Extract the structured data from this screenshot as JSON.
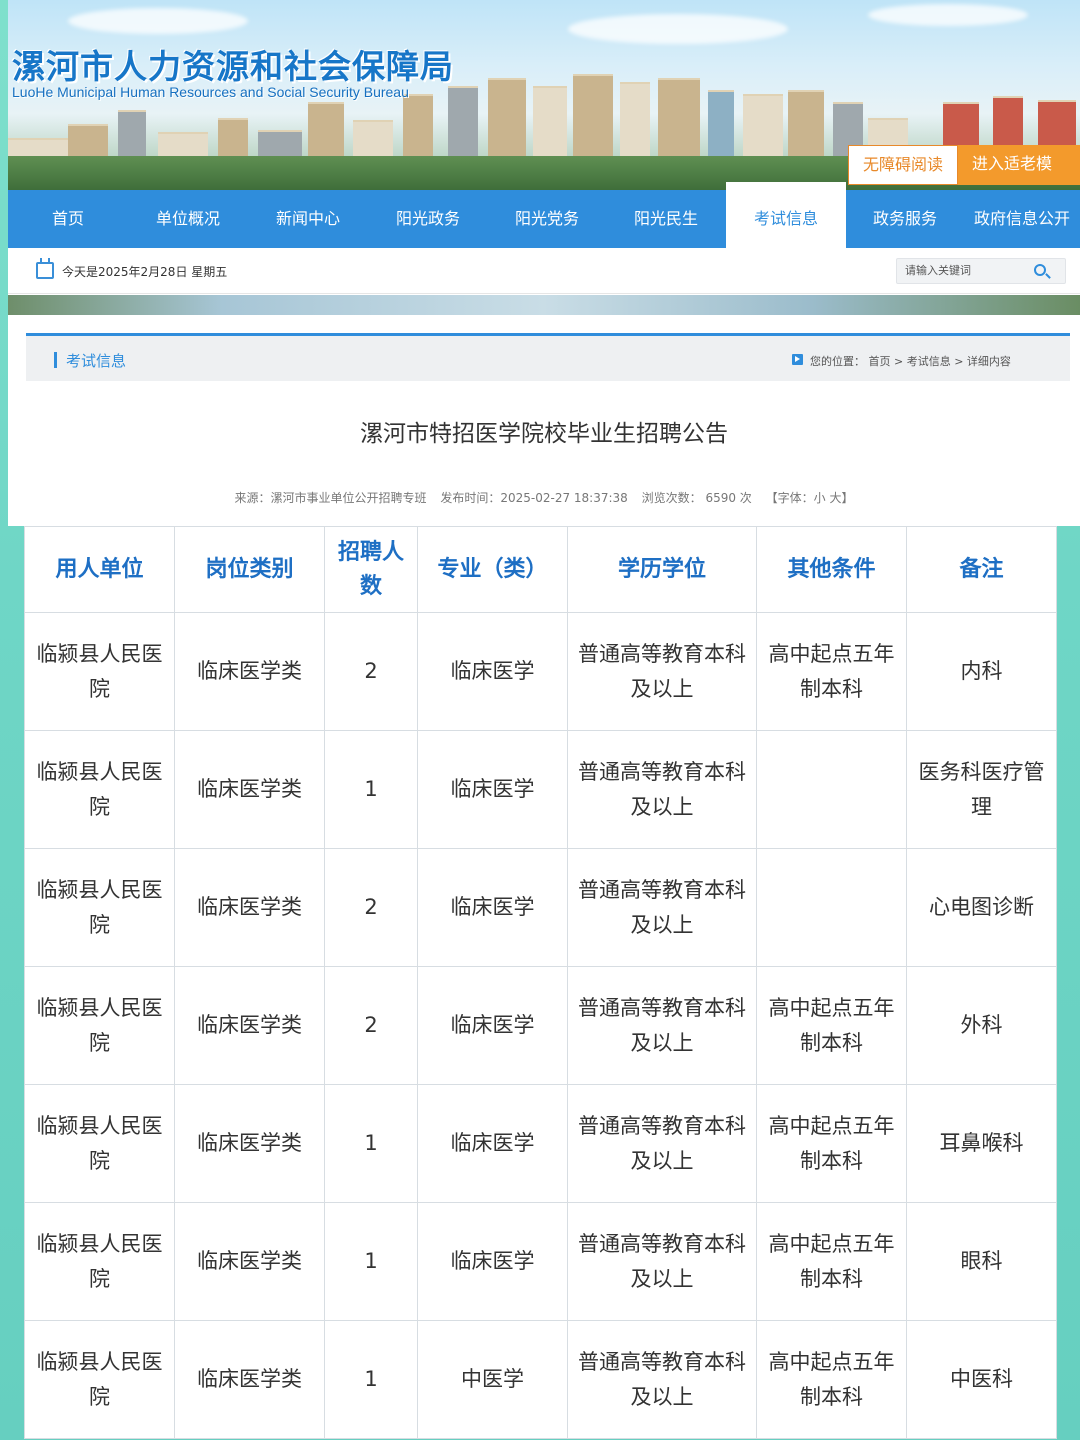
{
  "header": {
    "site_title": "漯河市人力资源和社会保障局",
    "site_subtitle": "LuoHe Municipal Human Resources and Social Security Bureau",
    "accessible_reading": "无障碍阅读",
    "elderly_mode": "进入适老模式"
  },
  "nav": {
    "items": [
      "首页",
      "单位概况",
      "新闻中心",
      "阳光政务",
      "阳光党务",
      "阳光民生",
      "考试信息",
      "政务服务",
      "政府信息公开"
    ],
    "active": "考试信息"
  },
  "infobar": {
    "date": "今天是2025年2月28日 星期五",
    "search_placeholder": "请输入关键词"
  },
  "breadcrumb": {
    "section": "考试信息",
    "path": "您的位置： 首页 > 考试信息 > 详细内容"
  },
  "article": {
    "title": "漯河市特招医学院校毕业生招聘公告",
    "source": "来源：漯河市事业单位公开招聘专班",
    "publish_time": "发布时间：2025-02-27 18:37:38",
    "views": "浏览次数：  6590  次",
    "font_size": "【字体：小 大】"
  },
  "table": {
    "headers": [
      "用人单位",
      "岗位类别",
      "招聘人数",
      "专业（类）",
      "学历学位",
      "其他条件",
      "备注"
    ],
    "rows": [
      [
        "临颍县人民医院",
        "临床医学类",
        "2",
        "临床医学",
        "普通高等教育本科及以上",
        "高中起点五年制本科",
        "内科"
      ],
      [
        "临颍县人民医院",
        "临床医学类",
        "1",
        "临床医学",
        "普通高等教育本科及以上",
        "",
        "医务科医疗管理"
      ],
      [
        "临颍县人民医院",
        "临床医学类",
        "2",
        "临床医学",
        "普通高等教育本科及以上",
        "",
        "心电图诊断"
      ],
      [
        "临颍县人民医院",
        "临床医学类",
        "2",
        "临床医学",
        "普通高等教育本科及以上",
        "高中起点五年制本科",
        "外科"
      ],
      [
        "临颍县人民医院",
        "临床医学类",
        "1",
        "临床医学",
        "普通高等教育本科及以上",
        "高中起点五年制本科",
        "耳鼻喉科"
      ],
      [
        "临颍县人民医院",
        "临床医学类",
        "1",
        "临床医学",
        "普通高等教育本科及以上",
        "高中起点五年制本科",
        "眼科"
      ],
      [
        "临颍县人民医院",
        "临床医学类",
        "1",
        "中医学",
        "普通高等教育本科及以上",
        "高中起点五年制本科",
        "中医科"
      ]
    ]
  },
  "colors": {
    "primary": "#2f8ddc",
    "accent_orange": "#f39a2c",
    "header_text": "#1e6fc4",
    "background_teal": "#6fd6c6"
  }
}
